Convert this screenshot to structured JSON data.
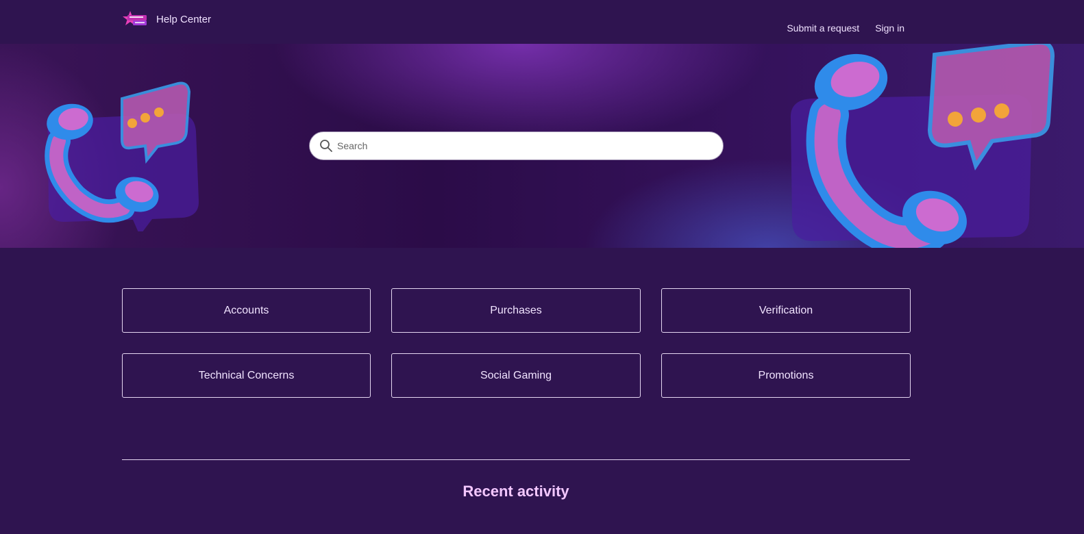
{
  "header": {
    "brand_title": "Help Center",
    "nav": {
      "submit_request": "Submit a request",
      "sign_in": "Sign in"
    }
  },
  "hero": {
    "search": {
      "placeholder": "Search",
      "value": ""
    }
  },
  "categories": [
    {
      "label": "Accounts"
    },
    {
      "label": "Purchases"
    },
    {
      "label": "Verification"
    },
    {
      "label": "Technical Concerns"
    },
    {
      "label": "Social Gaming"
    },
    {
      "label": "Promotions"
    }
  ],
  "recent_activity": {
    "title": "Recent activity"
  },
  "colors": {
    "background": "#2f1450",
    "text": "#f0e2ff",
    "accent_title": "#f3c7ff",
    "border": "#e6d8f2",
    "icon_blue": "#2f8bea",
    "icon_pink": "#c063c6",
    "dots": "#f2a43a"
  }
}
